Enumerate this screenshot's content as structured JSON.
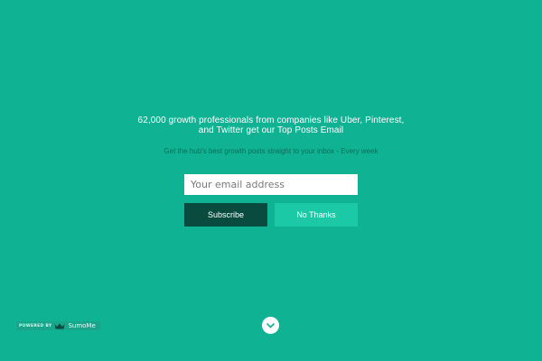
{
  "headline": {
    "line1": "62,000 growth professionals from companies like Uber, Pinterest,",
    "line2": "and Twitter get our Top Posts Email"
  },
  "subline": "Get the hub's best growth posts straight to your inbox - Every week",
  "form": {
    "email_placeholder": "Your email address",
    "subscribe_label": "Subscribe",
    "no_thanks_label": "No Thanks"
  },
  "badge": {
    "powered_by": "POWERED BY",
    "brand": "SumoMe",
    "icon": "crown-icon"
  },
  "scroll_icon": "chevron-down-icon",
  "colors": {
    "background": "#0fb293",
    "subscribe": "#0a4b40",
    "no_thanks": "#1bc9a6"
  }
}
